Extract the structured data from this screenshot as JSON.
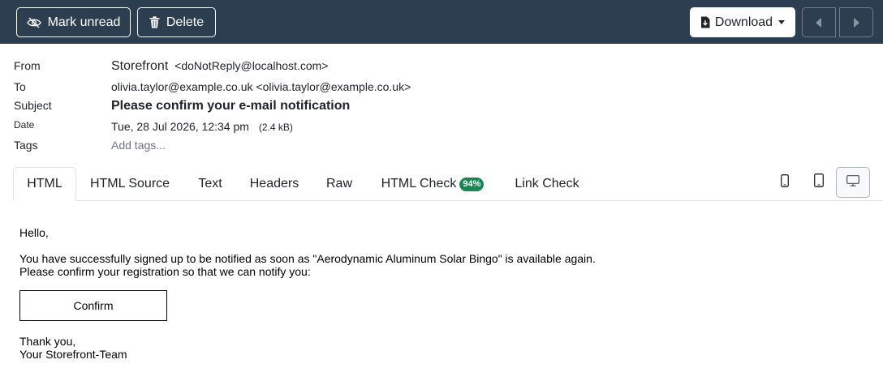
{
  "toolbar": {
    "mark_unread_label": "Mark unread",
    "delete_label": "Delete",
    "download_label": "Download",
    "icons": [
      "eye-slash-icon",
      "trash-icon",
      "download-file-icon",
      "caret-down-icon",
      "prev-arrow-icon",
      "next-arrow-icon"
    ]
  },
  "meta": {
    "from_label": "From",
    "from_name": "Storefront",
    "from_address": "<doNotReply@localhost.com>",
    "to_label": "To",
    "to_value": "olivia.taylor@example.co.uk <olivia.taylor@example.co.uk>",
    "subject_label": "Subject",
    "subject_value": "Please confirm your e-mail notification",
    "date_label": "Date",
    "date_value": "Tue, 28 Jul 2026, 12:34 pm",
    "size_value": "(2.4 kB)",
    "tags_label": "Tags",
    "tags_placeholder": "Add tags..."
  },
  "tabs": {
    "html": "HTML",
    "html_source": "HTML Source",
    "text": "Text",
    "headers": "Headers",
    "raw": "Raw",
    "html_check": "HTML Check",
    "html_check_badge": "94%",
    "link_check": "Link Check",
    "active": "HTML",
    "device_icons": [
      "phone-icon",
      "tablet-icon",
      "desktop-icon"
    ],
    "active_device": "desktop-icon"
  },
  "email": {
    "greeting": "Hello,",
    "line1": "You have successfully signed up to be notified as soon as \"Aerodynamic Aluminum Solar Bingo\" is available again.",
    "line2": "Please confirm your registration so that we can notify you:",
    "confirm_label": "Confirm",
    "thanks": "Thank you,",
    "signature": "Your Storefront-Team"
  },
  "colors": {
    "toolbar_bg": "#2c3e50",
    "badge_bg": "#198754",
    "muted_text": "#6c757d"
  }
}
